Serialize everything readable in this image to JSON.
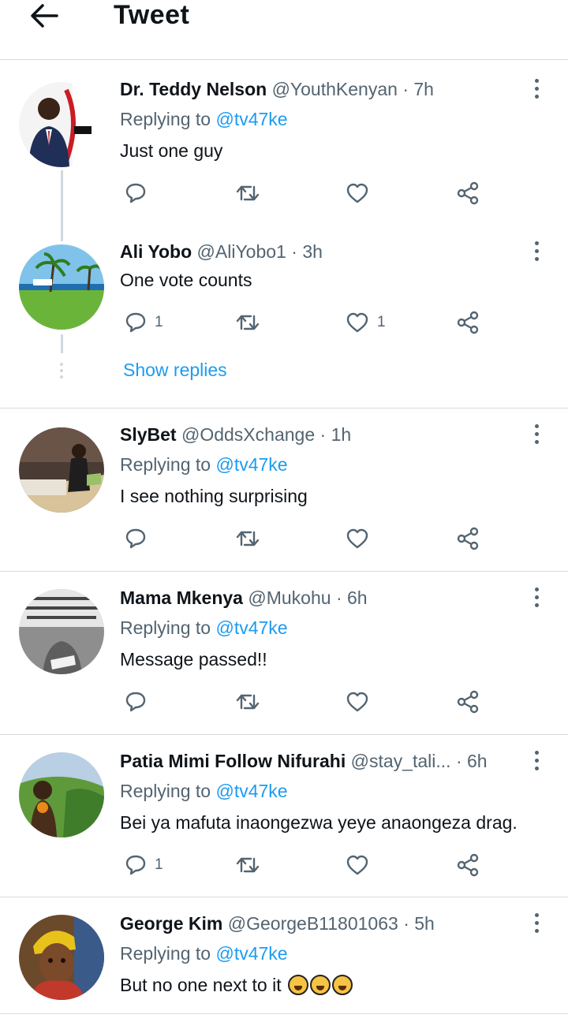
{
  "header": {
    "title": "Tweet"
  },
  "show_replies_label": "Show replies",
  "tweets": [
    {
      "name": "Dr. Teddy Nelson",
      "handle": "@YouthKenyan",
      "sep": "·",
      "time": "7h",
      "replying_prefix": "Replying to",
      "replying_to": "@tv47ke",
      "text": "Just one guy",
      "reply_count": "",
      "like_count": ""
    },
    {
      "name": "Ali Yobo",
      "handle": "@AliYobo1",
      "sep": "·",
      "time": "3h",
      "text": "One vote counts",
      "reply_count": "1",
      "like_count": "1"
    },
    {
      "name": "SlyBet",
      "handle": "@OddsXchange",
      "sep": "·",
      "time": "1h",
      "replying_prefix": "Replying to",
      "replying_to": "@tv47ke",
      "text": "I see nothing surprising",
      "reply_count": "",
      "like_count": ""
    },
    {
      "name": "Mama Mkenya",
      "handle": "@Mukohu",
      "sep": "·",
      "time": "6h",
      "replying_prefix": "Replying to",
      "replying_to": "@tv47ke",
      "text": "Message passed!!",
      "reply_count": "",
      "like_count": ""
    },
    {
      "name": "Patia Mimi Follow Nifurahi",
      "handle": "@stay_tali...",
      "sep": "·",
      "time": "6h",
      "replying_prefix": "Replying to",
      "replying_to": "@tv47ke",
      "text": "Bei ya mafuta inaongezwa yeye anaongeza drag.",
      "reply_count": "1",
      "like_count": ""
    },
    {
      "name": "George Kim",
      "handle": "@GeorgeB11801063",
      "sep": "·",
      "time": "5h",
      "replying_prefix": "Replying to",
      "replying_to": "@tv47ke",
      "text": "But no one next to it",
      "emojis": [
        "rolling-on-floor-laughing",
        "rolling-on-floor-laughing",
        "rolling-on-floor-laughing"
      ],
      "reply_count": "",
      "like_count": ""
    }
  ],
  "colors": {
    "accent": "#1d9bf0",
    "muted": "#536471",
    "text": "#0f1419",
    "divider": "#d6dbdf"
  }
}
